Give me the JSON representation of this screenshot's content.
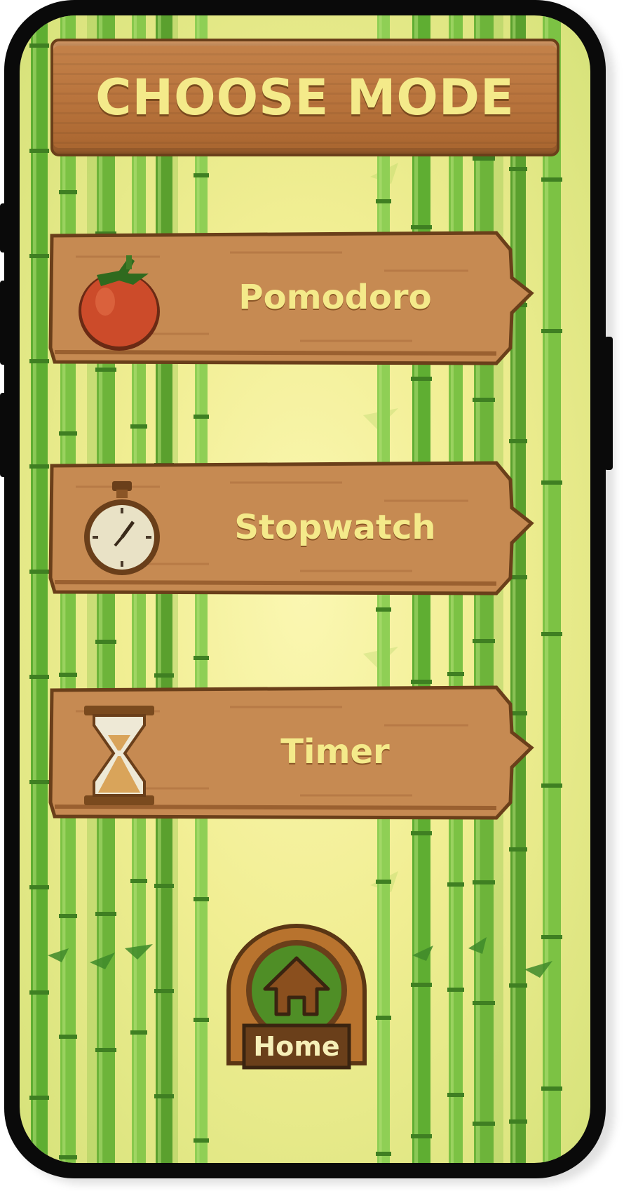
{
  "header": {
    "title": "CHOOSE MODE"
  },
  "modes": [
    {
      "label": "Pomodoro",
      "icon": "tomato-icon"
    },
    {
      "label": "Stopwatch",
      "icon": "stopwatch-icon"
    },
    {
      "label": "Timer",
      "icon": "hourglass-icon"
    }
  ],
  "footer": {
    "home_label": "Home",
    "icon": "home-icon"
  },
  "colors": {
    "wood": "#c68a52",
    "wood_border": "#6a3f1a",
    "text": "#f4ea8a",
    "bamboo": "#6fb83a"
  }
}
